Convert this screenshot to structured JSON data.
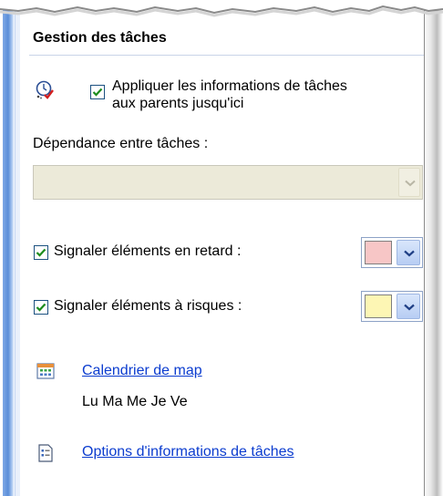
{
  "section_title": "Gestion des tâches",
  "apply_checkbox": {
    "checked": true,
    "line1": "Appliquer les informations de tâches",
    "line2": "aux parents jusqu'ici"
  },
  "dependency": {
    "label": "Dépendance entre tâches :",
    "value": "",
    "disabled": true
  },
  "late_items": {
    "checked": true,
    "label": "Signaler éléments en retard :",
    "color": "#f7c6c6"
  },
  "risk_items": {
    "checked": true,
    "label": "Signaler éléments à risques :",
    "color": "#fdf6b4"
  },
  "calendar": {
    "link": "Calendrier de map",
    "days": "Lu Ma Me Je Ve",
    "icon": "calendar-icon"
  },
  "options": {
    "link": "Options d'informations de tâches",
    "icon": "document-icon"
  },
  "colors": {
    "accent": "#0b3ccf",
    "checkmark": "#1c8c1c",
    "left_bar": "#5b8ed8"
  }
}
